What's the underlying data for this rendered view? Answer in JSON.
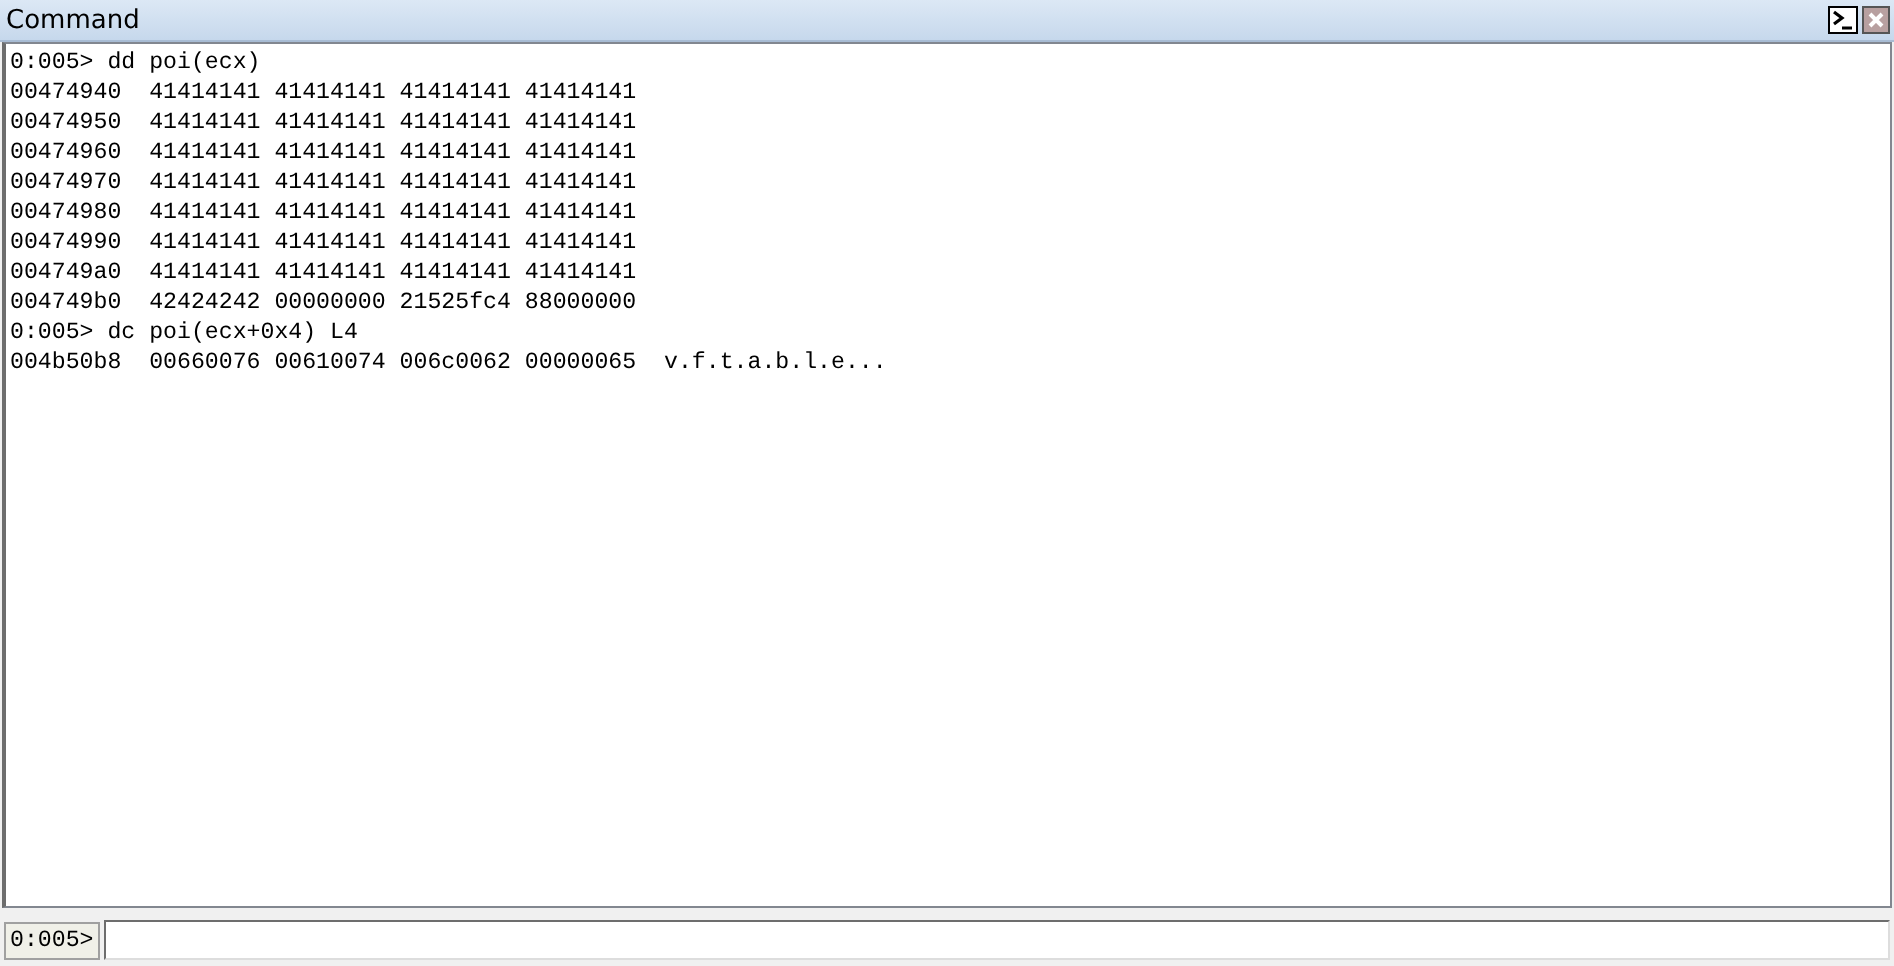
{
  "window": {
    "title": "Command"
  },
  "output": {
    "lines": [
      "0:005> dd poi(ecx)",
      "00474940  41414141 41414141 41414141 41414141",
      "00474950  41414141 41414141 41414141 41414141",
      "00474960  41414141 41414141 41414141 41414141",
      "00474970  41414141 41414141 41414141 41414141",
      "00474980  41414141 41414141 41414141 41414141",
      "00474990  41414141 41414141 41414141 41414141",
      "004749a0  41414141 41414141 41414141 41414141",
      "004749b0  42424242 00000000 21525fc4 88000000",
      "0:005> dc poi(ecx+0x4) L4",
      "004b50b8  00660076 00610074 006c0062 00000065  v.f.t.a.b.l.e..."
    ]
  },
  "command_bar": {
    "prompt": "0:005>"
  }
}
